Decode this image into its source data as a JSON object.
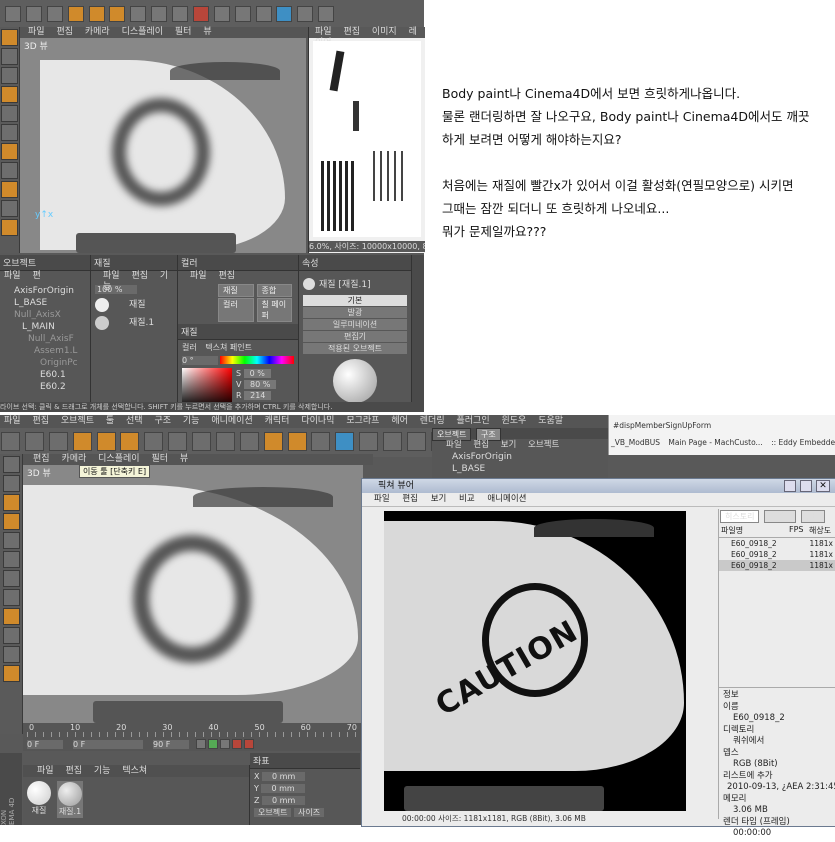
{
  "top_screenshot": {
    "menu": [
      "파일",
      "편집",
      "카메라",
      "디스플레이",
      "필터",
      "뷰"
    ],
    "viewport_label": "3D 뷰",
    "picture_viewer": {
      "menu": [
        "파일",
        "편집",
        "이미지",
        "레이어"
      ],
      "status": "6.0%, 사이즈: 10000x10000, 8"
    },
    "objects_panel": {
      "title": "오브젝트",
      "menu": [
        "파일",
        "편"
      ],
      "items": [
        "AxisForOrigin",
        "L_BASE",
        "Null_AxisX",
        "L_MAIN",
        "Null_AxisF",
        "Assem1.L",
        "OriginPc",
        "E60.1",
        "E60.2"
      ]
    },
    "materials_panel": {
      "title": "재질",
      "menu": [
        "파일",
        "편집",
        "기능"
      ],
      "zoom": "100 %",
      "materials": [
        "재질",
        "재질.1"
      ]
    },
    "color_panel": {
      "title": "컬러",
      "menu": [
        "파일",
        "편집"
      ],
      "layer_opts": [
        "재질",
        "종합",
        "컬러",
        "칠 페이퍼"
      ],
      "section": "재질",
      "radio": [
        "컬러",
        "텍스쳐 페인트"
      ],
      "hue": "0 °",
      "s": "0 %",
      "v": "80 %",
      "r": "214"
    },
    "attributes_panel": {
      "title": "속성",
      "material_name": "재질 [재질.1]",
      "tabs": [
        "기본",
        "발광",
        "일루미네이션",
        "편집기",
        "적용된 오브젝트"
      ]
    },
    "status_line": "라이브 선택: 클릭 & 드래그로 개체를 선택합니다. SHIFT 키를 누르면서 선택을 추가하며 CTRL 키를 삭제합니다."
  },
  "question_text": {
    "lines": [
      "Body paint나 Cinema4D에서 보면 흐릿하게나옵니다.",
      "물론 랜더링하면 잘 나오구요, Body paint나 Cinema4D에서도 깨끗",
      "하게 보려면 어떻게 해야하는지요?",
      "",
      "처음에는 재질에 빨간x가 있어서 이걸 활성화(연필모양으로) 시키면",
      "그때는 잠깐 되더니 또 흐릿하게 나오네요...",
      "뭐가 문제일까요???"
    ]
  },
  "bottom_screenshot": {
    "menu": [
      "파일",
      "편집",
      "오브젝트",
      "툴",
      "선택",
      "구조",
      "기능",
      "애니메이션",
      "캐릭터",
      "다이나믹",
      "모그라프",
      "헤어",
      "렌더링",
      "플러그인",
      "윈도우",
      "도움말"
    ],
    "view_menu": [
      "편집",
      "카메라",
      "디스플레이",
      "필터",
      "뷰"
    ],
    "viewport_label": "3D 뷰",
    "tooltip": "이동 툴 [단축키 E]",
    "objects_tabs": [
      "오브젝트",
      "구조"
    ],
    "objects_menu": [
      "파일",
      "편집",
      "보기",
      "오브젝트"
    ],
    "objects": [
      "AxisForOrigin",
      "L_BASE"
    ],
    "browser": {
      "url_fragment": "#dispMemberSignUpForm",
      "tabs": [
        "_VB_ModBUS",
        "Main Page - MachCusto...",
        ":: Eddy Embedded Mod..."
      ]
    },
    "timeline": {
      "ticks": [
        "0",
        "10",
        "20",
        "30",
        "40",
        "50",
        "60",
        "70"
      ],
      "start": "0 F",
      "current": "0 F",
      "end": "90 F"
    },
    "materials": {
      "menu": [
        "파일",
        "편집",
        "기능",
        "텍스쳐"
      ],
      "items": [
        "재질",
        "재질.1"
      ]
    },
    "coords": {
      "title": "좌표",
      "labels": [
        "X",
        "Y",
        "Z"
      ],
      "values": [
        "0 mm",
        "0 mm",
        "0 mm"
      ],
      "mode": "오브젝트",
      "size": "사이즈"
    },
    "side_text": "XON\nEMA 4D",
    "picture_viewer": {
      "title": "픽쳐 뷰어",
      "menu": [
        "파일",
        "편집",
        "보기",
        "비교",
        "애니메이션"
      ],
      "caution_text": "CAUTION",
      "tabs": [
        "히스토리",
        "레이어",
        "필터"
      ],
      "table_headers": [
        "파일명",
        "FPS",
        "해상도"
      ],
      "files": [
        {
          "name": "E60_0918_2",
          "res": "1181x"
        },
        {
          "name": "E60_0918_2",
          "res": "1181x"
        },
        {
          "name": "E60_0918_2",
          "res": "1181x"
        }
      ],
      "info": [
        {
          "label": "정보",
          "value": ""
        },
        {
          "label": "이름",
          "value": "E60_0918_2"
        },
        {
          "label": "디렉토리",
          "value": "쿼쉬에서"
        },
        {
          "label": "뎁스",
          "value": "RGB (8Bit)"
        },
        {
          "label": "리스트에 추가",
          "value": "2010-09-13, ¿AEA 2:31:45"
        },
        {
          "label": "메모리",
          "value": "3.06 MB"
        },
        {
          "label": "렌더 타임 (프레임)",
          "value": "00:00:00"
        }
      ],
      "status": "00:00:00    사이즈: 1181x1181, RGB (8Bit), 3.06 MB"
    }
  },
  "colors": {
    "c4d_bg": "#595959",
    "viewport": "#888888",
    "mesh": "#e7e7e7",
    "accent_orange": "#d08a2b"
  }
}
